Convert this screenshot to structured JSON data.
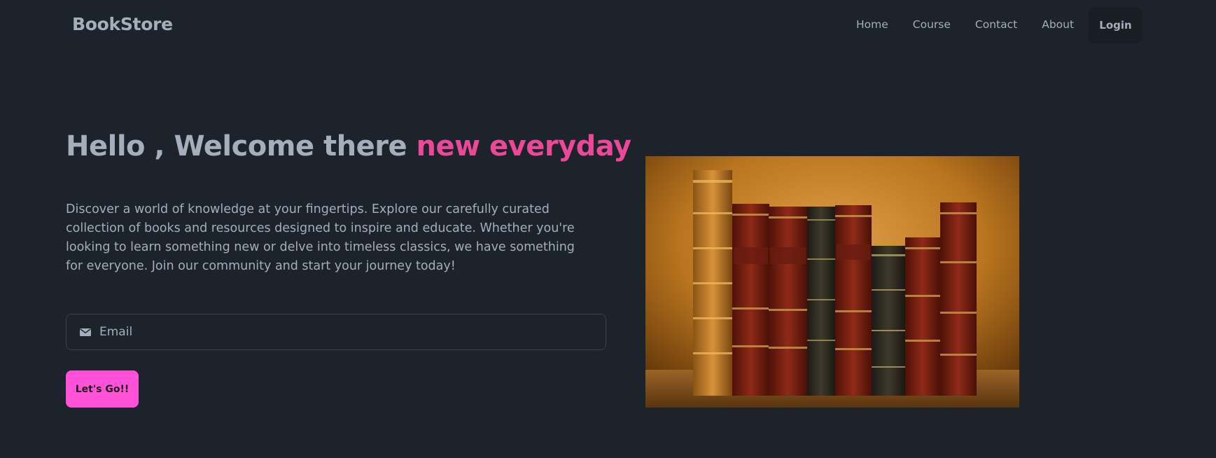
{
  "navbar": {
    "brand": "BookStore",
    "links": [
      {
        "label": "Home"
      },
      {
        "label": "Course"
      },
      {
        "label": "Contact"
      },
      {
        "label": "About"
      }
    ],
    "login_label": "Login"
  },
  "hero": {
    "title_main": "Hello , Welcome there ",
    "title_accent": "new everyday",
    "description": "Discover a world of knowledge at your fingertips. Explore our carefully curated collection of books and resources designed to inspire and educate. Whether you're looking to learn something new or delve into timeless classics, we have something for everyone. Join our community and start your journey today!",
    "email_placeholder": "Email",
    "email_icon": "envelope-icon",
    "cta_label": "Let's Go!!"
  },
  "colors": {
    "background": "#1d232a",
    "text": "#a6adbb",
    "accent": "#ec4899",
    "cta": "#ff52d9"
  }
}
